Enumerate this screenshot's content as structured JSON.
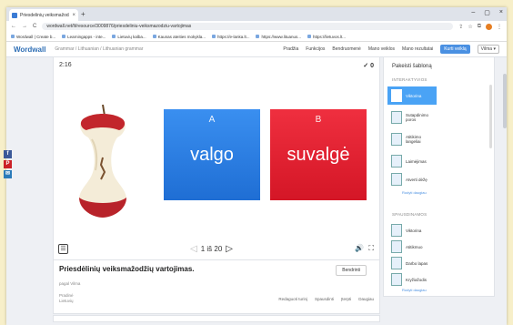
{
  "browser": {
    "tab_title": "Priesdelinių veiksmažodžių vart...",
    "tab_close": "×",
    "new_tab": "+",
    "window_controls": [
      "–",
      "▢",
      "×"
    ],
    "nav_glyphs": [
      "←",
      "→",
      "C"
    ],
    "url": "wordwall.net/lt/resource/3009876/priesdeliniu-veiksmazodziu-vartojimas",
    "bookmarks": [
      "Wordwall | Create b...",
      "Learningapps - inte...",
      "Lietuvių kalba...",
      "Kaunas ateities mokykla...",
      "https://e-lanka.lt...",
      "https://www.lituanus...",
      "https://lietuvos.lt..."
    ]
  },
  "site": {
    "logo": "Wordwall",
    "breadcrumb": "Grammar / Lithuanian / Lithuanian grammar",
    "nav": [
      "Pradžia",
      "Funkcijos",
      "Bendruomenė",
      "Mano veiklos",
      "Mano rezultatai"
    ],
    "create_label": "Kurti veiklą",
    "user_label": "Vilma",
    "user_glyph": "▾"
  },
  "activity": {
    "timer": "2:16",
    "score": "✓ 0",
    "cards": [
      {
        "letter": "A",
        "word": "valgo",
        "color": "#2b86ea"
      },
      {
        "letter": "B",
        "word": "suvalgė",
        "color": "#e11f30"
      }
    ],
    "pager": "1 iš 20",
    "menu_glyph": "☰",
    "prev_glyph": "◁",
    "next_glyph": "▷",
    "sound_glyph": "🔊",
    "fullscreen_glyph": "⛶"
  },
  "info": {
    "title": "Priesdėlinių veiksmažodžių vartojimas.",
    "share_label": "Bendrinti",
    "author": "pagal Vilma",
    "meta_lines": [
      "Pradinė",
      "Lietuvių"
    ],
    "actions": [
      "Redaguoti turinį",
      "Spausdinti",
      "Įterpti",
      "Daugiau"
    ]
  },
  "side": {
    "title": "Pakeisti šabloną",
    "section_interactive": "INTERAKTYVIOS",
    "options_interactive": [
      {
        "label": "Viktorina",
        "selected": true
      },
      {
        "label": "Sutapdinimo poros",
        "selected": false
      },
      {
        "label": "Atitikimo langeliai",
        "selected": false
      },
      {
        "label": "Laimėjimas",
        "selected": false
      },
      {
        "label": "Atverti dėžę",
        "selected": false
      }
    ],
    "more_label": "Rodyti daugiau",
    "section_printable": "SPAUSDINAMOS",
    "options_printable": [
      "Viktorina",
      "Atitikmuo",
      "Darbo lapas",
      "Kryžiažodis"
    ],
    "more_label_2": "Rodyti daugiau"
  },
  "social": [
    "f",
    "P",
    "✉"
  ]
}
